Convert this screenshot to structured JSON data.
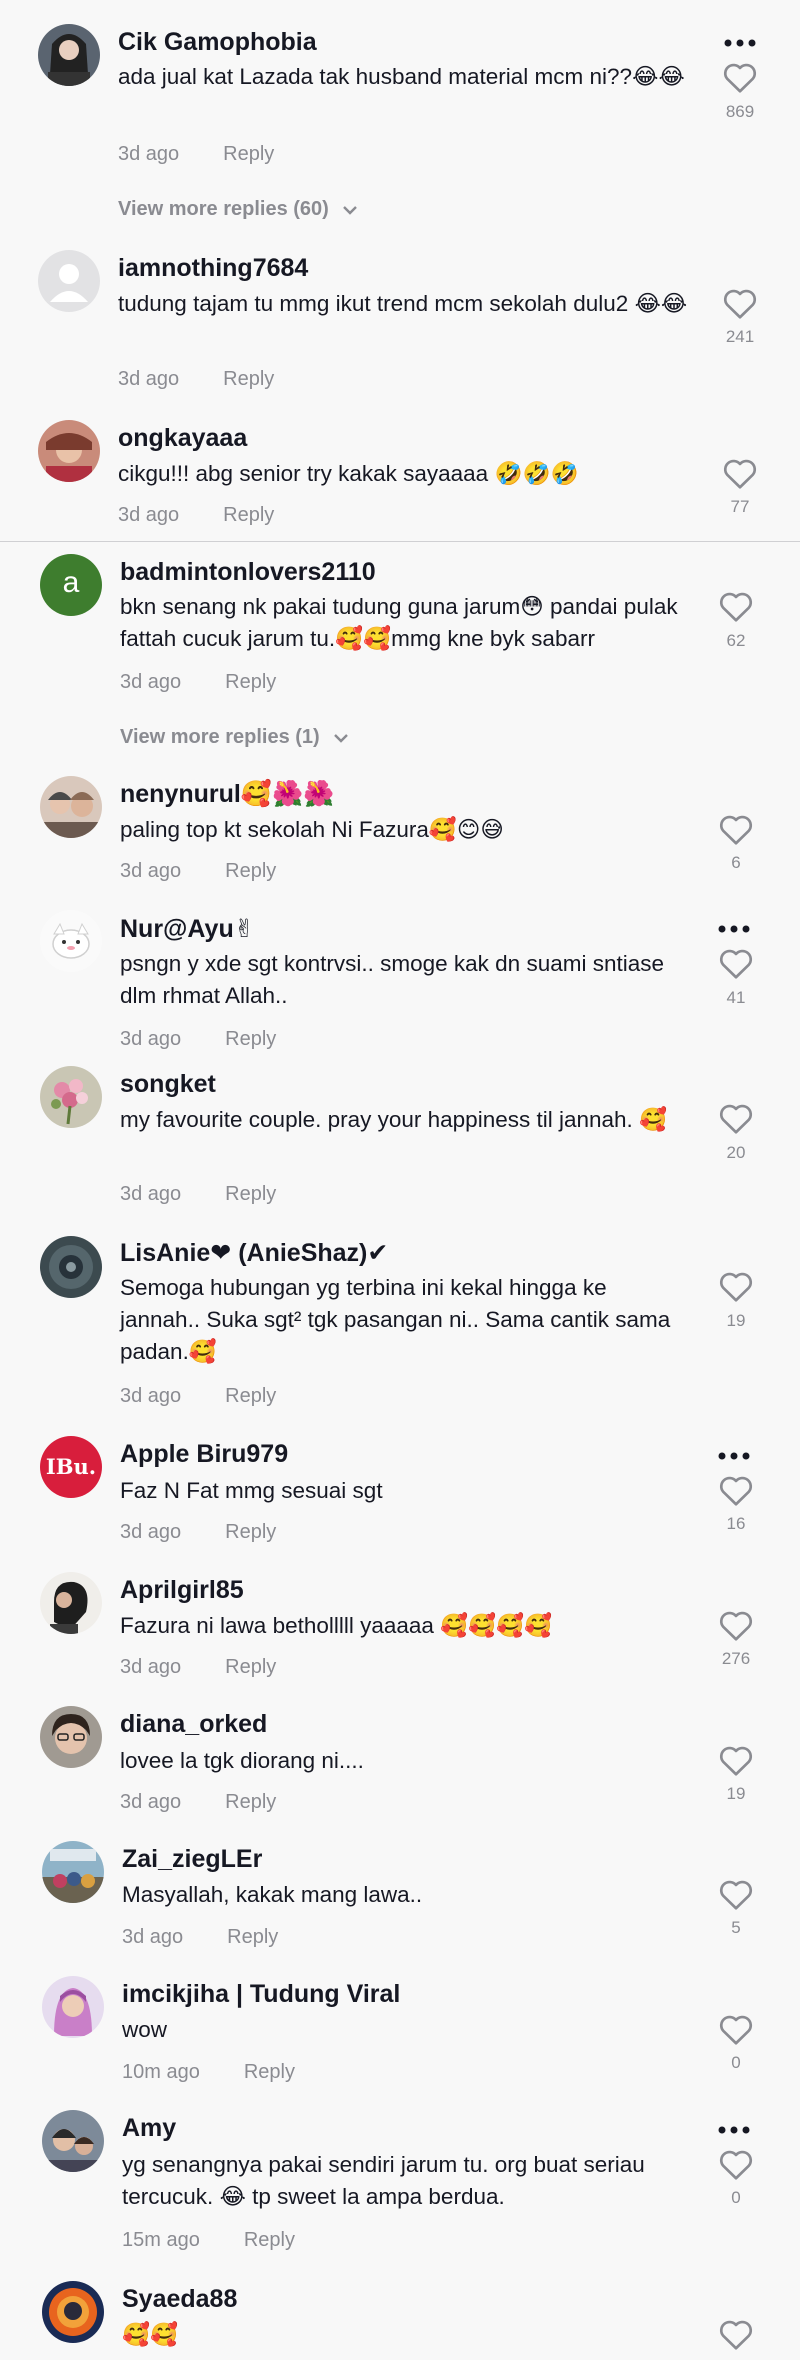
{
  "comments": [
    {
      "username": "Cik Gamophobia",
      "text": "ada jual kat Lazada tak husband material mcm ni??😂😂",
      "time": "3d ago",
      "reply": "Reply",
      "likes": "869"
    },
    {
      "username": "iamnothing7684",
      "text": "tudung tajam tu mmg ikut trend mcm sekolah dulu2 😂😂",
      "time": "3d ago",
      "reply": "Reply",
      "likes": "241"
    },
    {
      "username": "ongkayaaa",
      "text": "cikgu!!! abg senior try kakak sayaaaa 🤣🤣🤣",
      "time": "3d ago",
      "reply": "Reply",
      "likes": "77"
    },
    {
      "username": "badmintonlovers2110",
      "text": "bkn senang nk pakai tudung guna jarum😳 pandai pulak fattah cucuk jarum tu.🥰🥰mmg kne byk sabarr",
      "time": "3d ago",
      "reply": "Reply",
      "likes": "62"
    },
    {
      "username": "nenynurul🥰🌺🌺",
      "text": "paling top kt sekolah Ni Fazura🥰😊😅",
      "time": "3d ago",
      "reply": "Reply",
      "likes": "6"
    },
    {
      "username": "Nur@Ayu✌",
      "text": "psngn y xde sgt kontrvsi.. smoge kak dn suami sntiase dlm rhmat Allah..",
      "time": "3d ago",
      "reply": "Reply",
      "likes": "41"
    },
    {
      "username": "songket",
      "text": "my favourite couple. pray your happiness til jannah. 🥰",
      "time": "3d ago",
      "reply": "Reply",
      "likes": "20"
    },
    {
      "username": "LisAnie❤ (AnieShaz)✔",
      "text": "Semoga hubungan yg terbina ini kekal hingga ke jannah.. Suka sgt² tgk pasangan ni.. Sama cantik sama padan.🥰",
      "time": "3d ago",
      "reply": "Reply",
      "likes": "19"
    },
    {
      "username": "Apple Biru979",
      "text": "Faz N Fat mmg sesuai sgt",
      "time": "3d ago",
      "reply": "Reply",
      "likes": "16"
    },
    {
      "username": "Aprilgirl85",
      "text": "Fazura ni lawa betholllll yaaaaa 🥰🥰🥰🥰",
      "time": "3d ago",
      "reply": "Reply",
      "likes": "276"
    },
    {
      "username": "diana_orked",
      "text": "lovee la tgk diorang ni....",
      "time": "3d ago",
      "reply": "Reply",
      "likes": "19"
    },
    {
      "username": "Zai_ziegLEr",
      "text": "Masyallah, kakak mang lawa..",
      "time": "3d ago",
      "reply": "Reply",
      "likes": "5"
    },
    {
      "username": "imcikjiha | Tudung Viral",
      "text": "wow",
      "time": "10m ago",
      "reply": "Reply",
      "likes": "0"
    },
    {
      "username": "Amy",
      "text": "yg senangnya pakai sendiri jarum tu. org buat seriau tercucuk. 😂 tp sweet la ampa berdua.",
      "time": "15m ago",
      "reply": "Reply",
      "likes": "0"
    },
    {
      "username": "Syaeda88",
      "text": "🥰🥰",
      "time": "",
      "reply": "",
      "likes": ""
    }
  ],
  "view_more_replies": [
    "View more replies (60)",
    "View more replies (1)"
  ],
  "avatar_letter": "a",
  "avatar_ibu_text": "IBu."
}
